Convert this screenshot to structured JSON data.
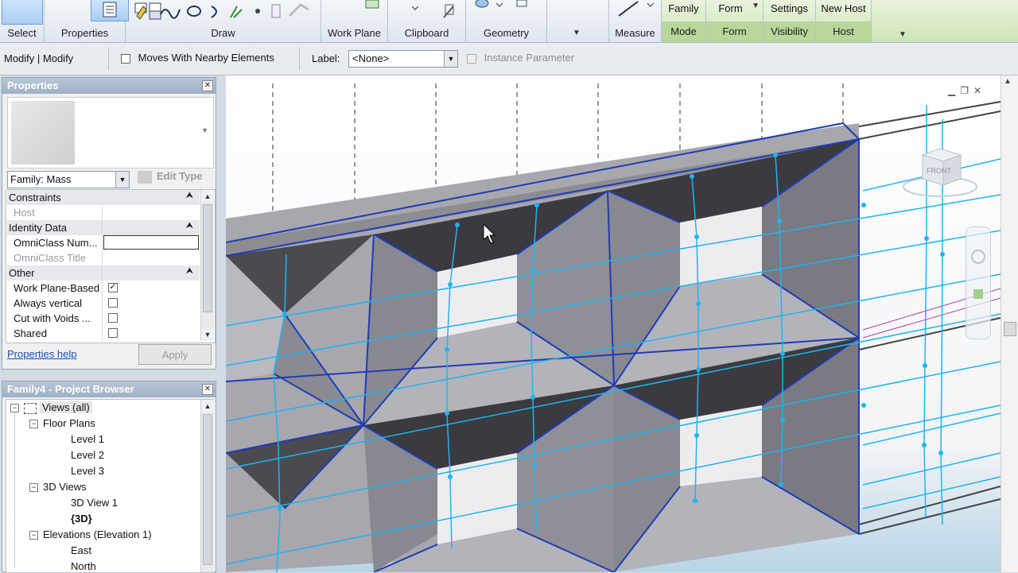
{
  "ribbon": {
    "panels": [
      {
        "label": "Select"
      },
      {
        "label": "Properties"
      },
      {
        "label": "Draw"
      },
      {
        "label": "Work Plane"
      },
      {
        "label": "Clipboard"
      },
      {
        "label": "Geometry"
      },
      {
        "label": "Measure"
      }
    ],
    "context_panels": [
      {
        "top": "Family",
        "label": "Mode"
      },
      {
        "top": "Form",
        "label": "Form"
      },
      {
        "top": "Settings",
        "label": "Visibility"
      },
      {
        "top": "New Host",
        "label": "Host"
      }
    ]
  },
  "options_bar": {
    "mode": "Modify | Modify",
    "moves_with_label": "Moves With Nearby Elements",
    "moves_with_checked": false,
    "label_caption": "Label:",
    "label_value": "<None>",
    "instance_param_label": "Instance Parameter"
  },
  "properties_panel": {
    "title": "Properties",
    "family_selector": "Family: Mass",
    "edit_type": "Edit Type",
    "groups": [
      {
        "name": "Constraints",
        "rows": [
          {
            "key": "Host",
            "value": ""
          }
        ]
      },
      {
        "name": "Identity Data",
        "rows": [
          {
            "key": "OmniClass Num...",
            "value": ""
          },
          {
            "key": "OmniClass Title",
            "value": ""
          }
        ]
      },
      {
        "name": "Other",
        "rows": [
          {
            "key": "Work Plane-Based",
            "checked": true
          },
          {
            "key": "Always vertical",
            "checked": false
          },
          {
            "key": "Cut with Voids ...",
            "checked": false
          },
          {
            "key": "Shared",
            "checked": false
          }
        ]
      }
    ],
    "help_link": "Properties help",
    "apply": "Apply"
  },
  "project_browser": {
    "title": "Family4 - Project Browser",
    "root": "Views (all)",
    "nodes": [
      {
        "label": "Floor Plans",
        "level": 1
      },
      {
        "label": "Level 1",
        "level": 2
      },
      {
        "label": "Level 2",
        "level": 2
      },
      {
        "label": "Level 3",
        "level": 2
      },
      {
        "label": "3D Views",
        "level": 1
      },
      {
        "label": "3D View 1",
        "level": 2
      },
      {
        "label": "{3D}",
        "level": 2,
        "bold": true
      },
      {
        "label": "Elevations (Elevation 1)",
        "level": 1
      },
      {
        "label": "East",
        "level": 2
      },
      {
        "label": "North",
        "level": 2
      }
    ]
  },
  "viewport": {
    "viewcube_face": "FRONT"
  },
  "colors": {
    "edge_blue": "#1e3cb4",
    "grid_cyan": "#1fb4f0",
    "dark_face": "#3a3a3f",
    "light_face": "#9a9aa2"
  }
}
